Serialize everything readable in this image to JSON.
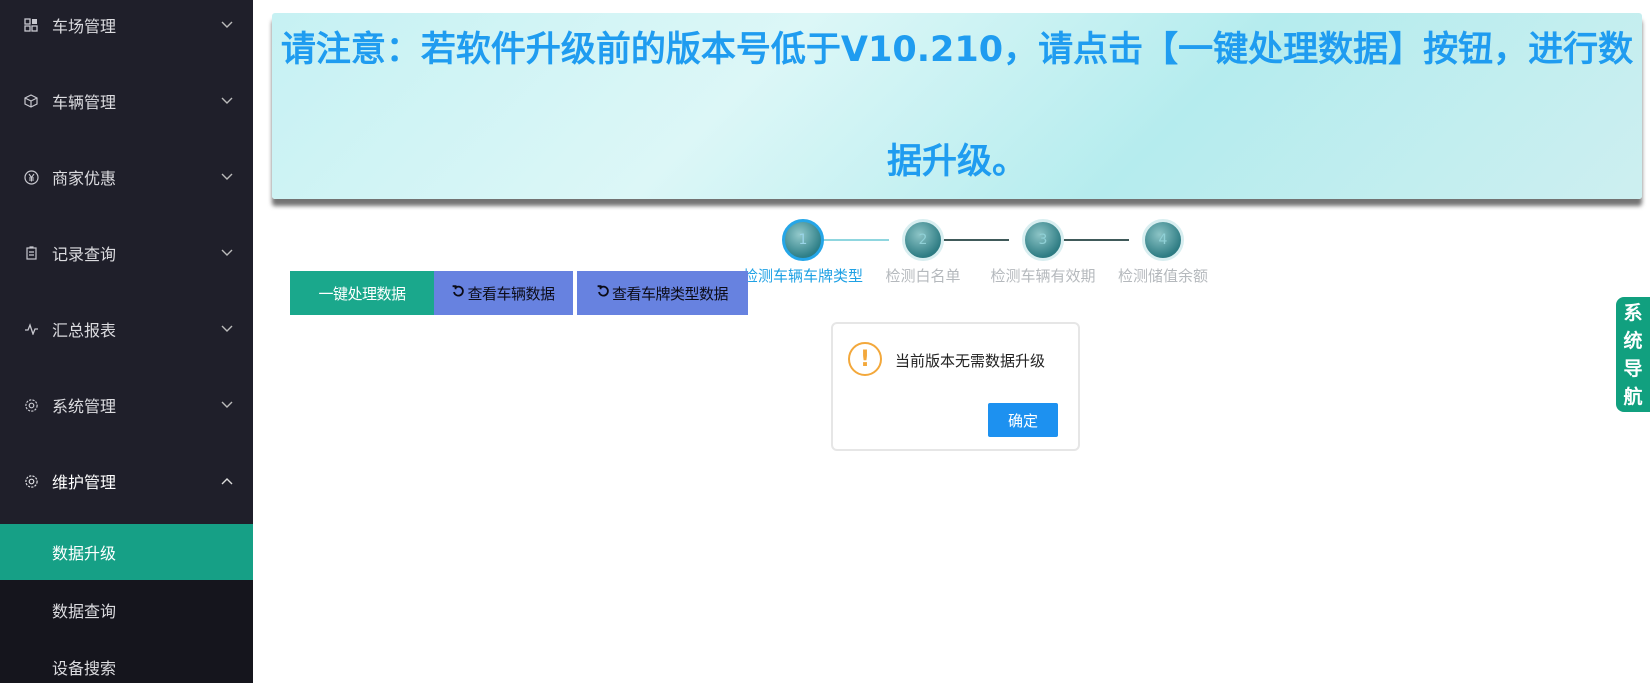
{
  "sidebar": {
    "groups": [
      {
        "label": "车场管理",
        "icon": "grid-icon",
        "expanded": false
      },
      {
        "label": "车辆管理",
        "icon": "cube-icon",
        "expanded": false
      },
      {
        "label": "商家优惠",
        "icon": "yen-circle-icon",
        "expanded": false
      },
      {
        "label": "记录查询",
        "icon": "document-icon",
        "expanded": false
      },
      {
        "label": "汇总报表",
        "icon": "pulse-icon",
        "expanded": false
      },
      {
        "label": "系统管理",
        "icon": "gear-icon",
        "expanded": false
      },
      {
        "label": "维护管理",
        "icon": "gear-icon",
        "expanded": true
      }
    ],
    "sub_items": [
      {
        "label": "数据升级",
        "active": true
      },
      {
        "label": "数据查询",
        "active": false
      },
      {
        "label": "设备搜索",
        "active": false
      }
    ]
  },
  "notice": {
    "text": "请注意：若软件升级前的版本号低于V10.210，请点击【一键处理数据】按钮，进行数据升级。"
  },
  "steps": [
    {
      "number": "1",
      "label": "检测车辆车牌类型",
      "active": true
    },
    {
      "number": "2",
      "label": "检测白名单",
      "active": false
    },
    {
      "number": "3",
      "label": "检测车辆有效期",
      "active": false
    },
    {
      "number": "4",
      "label": "检测储值余额",
      "active": false
    }
  ],
  "buttons": {
    "process": "一键处理数据",
    "view_vehicle": "查看车辆数据",
    "view_plate_type": "查看车牌类型数据"
  },
  "dialog": {
    "message": "当前版本无需数据升级",
    "ok": "确定"
  },
  "side_nav": {
    "chars": [
      "系",
      "统",
      "导",
      "航"
    ]
  },
  "colors": {
    "sidebar_bg": "#1f1f2a",
    "active_menu": "#16a086",
    "notice_text": "#1f9cf0",
    "primary_green": "#1aa88c",
    "secondary_blue": "#6782e0",
    "dialog_ok": "#1d91f0",
    "warning": "#f3a83b"
  }
}
